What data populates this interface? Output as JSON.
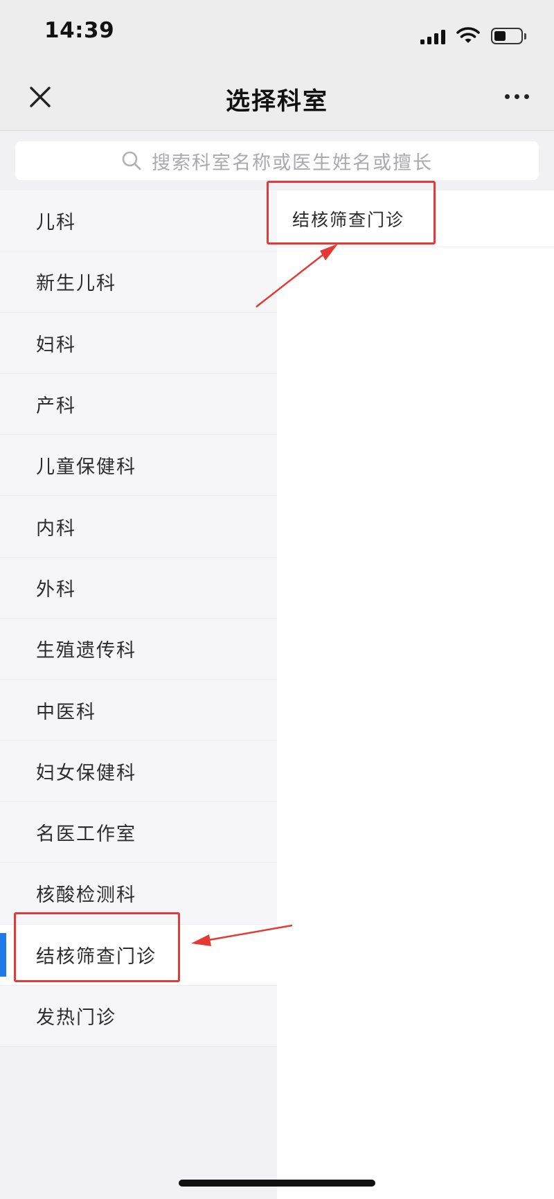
{
  "status_bar": {
    "time": "14:39",
    "icons": [
      "signal-icon",
      "wifi-icon",
      "battery-icon"
    ]
  },
  "nav": {
    "title": "选择科室",
    "close_icon": "close-icon",
    "more_icon": "more-icon"
  },
  "search": {
    "placeholder": "搜索科室名称或医生姓名或擅长",
    "icon": "search-icon"
  },
  "departments": [
    {
      "label": "儿科"
    },
    {
      "label": "新生儿科"
    },
    {
      "label": "妇科"
    },
    {
      "label": "产科"
    },
    {
      "label": "儿童保健科"
    },
    {
      "label": "内科"
    },
    {
      "label": "外科"
    },
    {
      "label": "生殖遗传科"
    },
    {
      "label": "中医科"
    },
    {
      "label": "妇女保健科"
    },
    {
      "label": "名医工作室"
    },
    {
      "label": "核酸检测科"
    },
    {
      "label": "结核筛查门诊",
      "selected": true
    },
    {
      "label": "发热门诊"
    }
  ],
  "sub_departments": [
    {
      "label": "结核筛查门诊"
    }
  ],
  "colors": {
    "accent": "#1f7aea",
    "annotation": "#e53935",
    "background": "#ededed"
  }
}
